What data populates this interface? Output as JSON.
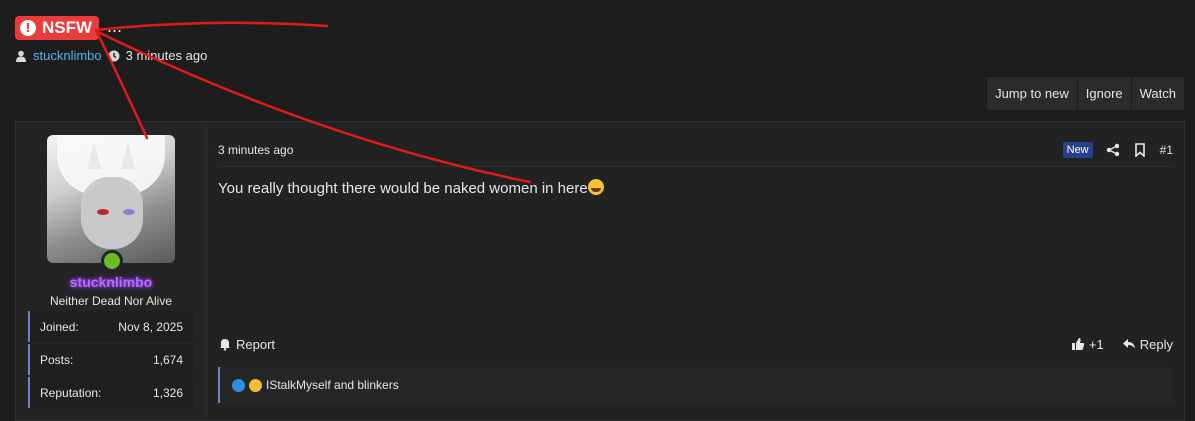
{
  "thread": {
    "prefix": "NSFW",
    "title_text": "...",
    "author": "stucknlimbo",
    "time_ago": "3 minutes ago"
  },
  "thread_actions": [
    "Jump to new",
    "Ignore",
    "Watch"
  ],
  "user": {
    "name": "stucknlimbo",
    "title": "Neither Dead Nor Alive",
    "stats": [
      {
        "label": "Joined:",
        "value": "Nov 8, 2025"
      },
      {
        "label": "Posts:",
        "value": "1,674"
      },
      {
        "label": "Reputation:",
        "value": "1,326"
      }
    ]
  },
  "post": {
    "time": "3 minutes ago",
    "badge": "New",
    "number": "#1",
    "body": "You really thought there would be naked women in here",
    "report_label": "Report",
    "like_count": "+1",
    "reply_label": "Reply",
    "reactions_text": "IStalkMyself and blinkers"
  },
  "colors": {
    "prefix_bg": "#ea3c3c",
    "link": "#52b6e8",
    "username": "#b86cf0",
    "accent_border": "#6d7fd6",
    "annotation_stroke": "#e01b1b"
  }
}
